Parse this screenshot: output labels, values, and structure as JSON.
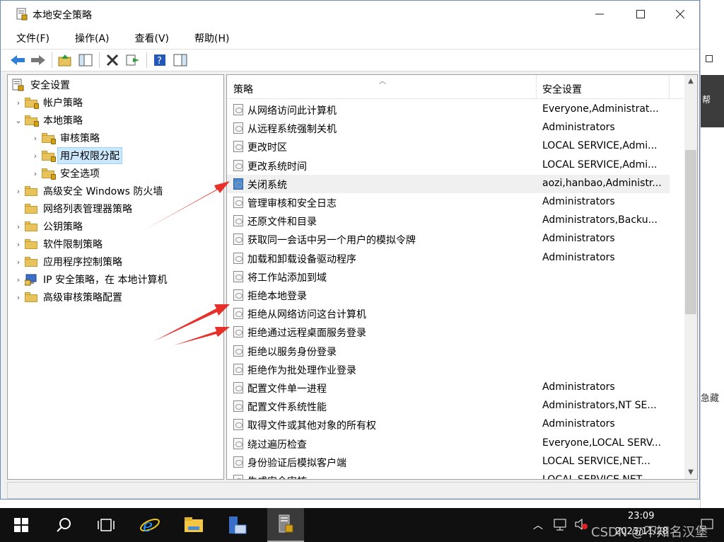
{
  "window": {
    "title": "本地安全策略"
  },
  "menu": [
    "文件(F)",
    "操作(A)",
    "查看(V)",
    "帮助(H)"
  ],
  "tree": [
    {
      "label": "安全设置",
      "icon": "security-settings-icon",
      "arrow": ""
    },
    {
      "label": "帐户策略",
      "icon": "folder-lock-icon",
      "arrow": "›"
    },
    {
      "label": "本地策略",
      "icon": "folder-lock-icon",
      "arrow": "⌄"
    },
    {
      "label": "审核策略",
      "icon": "folder-lock-icon",
      "arrow": "›"
    },
    {
      "label": "用户权限分配",
      "icon": "folder-lock-icon",
      "arrow": "›",
      "selected": true
    },
    {
      "label": "安全选项",
      "icon": "folder-lock-icon",
      "arrow": "›"
    },
    {
      "label": "高级安全 Windows 防火墙",
      "icon": "folder-icon",
      "arrow": "›"
    },
    {
      "label": "网络列表管理器策略",
      "icon": "folder-icon",
      "arrow": ""
    },
    {
      "label": "公钥策略",
      "icon": "folder-icon",
      "arrow": "›"
    },
    {
      "label": "软件限制策略",
      "icon": "folder-icon",
      "arrow": "›"
    },
    {
      "label": "应用程序控制策略",
      "icon": "folder-icon",
      "arrow": "›"
    },
    {
      "label": "IP 安全策略，在 本地计算机",
      "icon": "ip-security-icon",
      "arrow": "›"
    },
    {
      "label": "高级审核策略配置",
      "icon": "folder-icon",
      "arrow": "›"
    }
  ],
  "list": {
    "col_policy": "策略",
    "col_setting": "安全设置",
    "rows": [
      {
        "name": "从网络访问此计算机",
        "value": "Everyone,Administrat..."
      },
      {
        "name": "从远程系统强制关机",
        "value": "Administrators"
      },
      {
        "name": "更改时区",
        "value": "LOCAL SERVICE,Admi..."
      },
      {
        "name": "更改系统时间",
        "value": "LOCAL SERVICE,Admi..."
      },
      {
        "name": "关闭系统",
        "value": "aozi,hanbao,Administr...",
        "hover": true
      },
      {
        "name": "管理审核和安全日志",
        "value": "Administrators"
      },
      {
        "name": "还原文件和目录",
        "value": "Administrators,Backu..."
      },
      {
        "name": "获取同一会话中另一个用户的模拟令牌",
        "value": "Administrators"
      },
      {
        "name": "加载和卸载设备驱动程序",
        "value": "Administrators"
      },
      {
        "name": "将工作站添加到域",
        "value": ""
      },
      {
        "name": "拒绝本地登录",
        "value": ""
      },
      {
        "name": "拒绝从网络访问这台计算机",
        "value": ""
      },
      {
        "name": "拒绝通过远程桌面服务登录",
        "value": ""
      },
      {
        "name": "拒绝以服务身份登录",
        "value": ""
      },
      {
        "name": "拒绝作为批处理作业登录",
        "value": ""
      },
      {
        "name": "配置文件单一进程",
        "value": "Administrators"
      },
      {
        "name": "配置文件系统性能",
        "value": "Administrators,NT SE..."
      },
      {
        "name": "取得文件或其他对象的所有权",
        "value": "Administrators"
      },
      {
        "name": "绕过遍历检查",
        "value": "Everyone,LOCAL SERV..."
      },
      {
        "name": "身份验证后模拟客户端",
        "value": "LOCAL SERVICE,NET..."
      },
      {
        "name": "生成安全审核",
        "value": "LOCAL SERVICE,NET..."
      }
    ]
  },
  "taskbar": {
    "time": "23:09",
    "date": "2023/11/28"
  },
  "background": {
    "t1": ")",
    "t2": "帮",
    "t3": "急藏"
  },
  "watermark": "CSDN @不知名汉堡",
  "colors": {
    "accent": "#0078d7",
    "arrow": "#e8302a"
  }
}
